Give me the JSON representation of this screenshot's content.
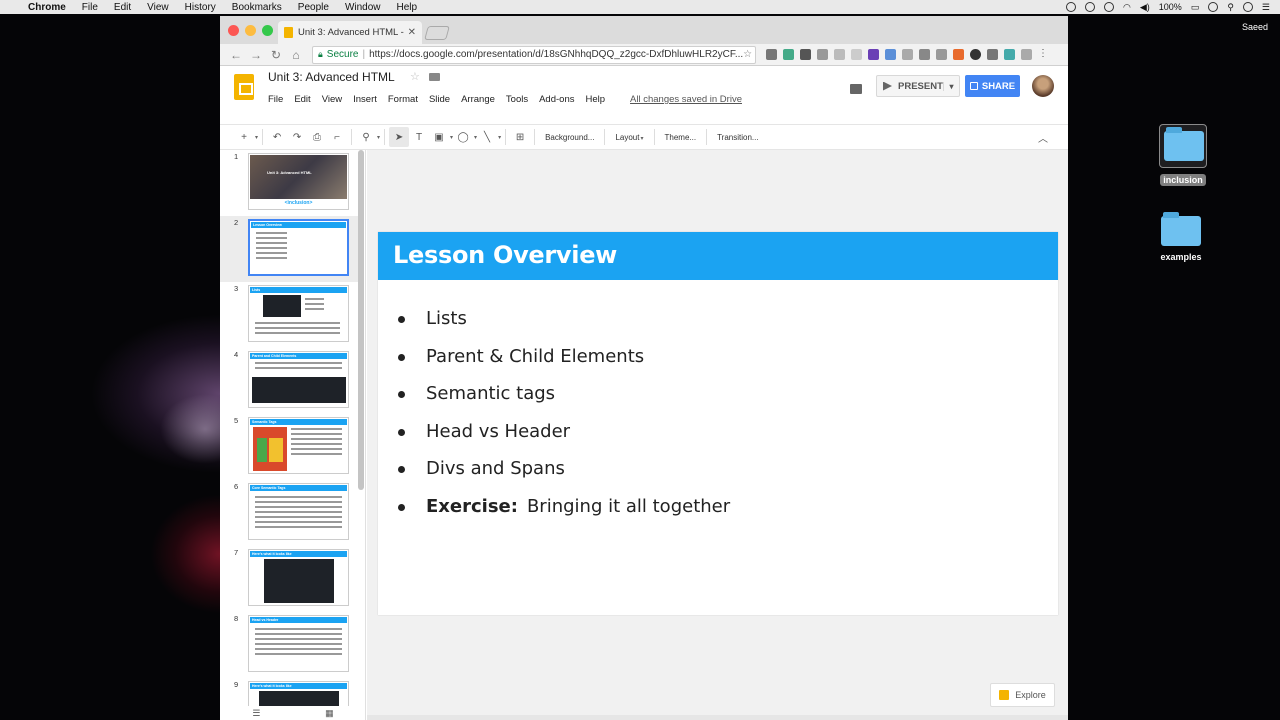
{
  "menubar": {
    "app": "Chrome",
    "items": [
      "File",
      "Edit",
      "View",
      "History",
      "Bookmarks",
      "People",
      "Window",
      "Help"
    ],
    "battery": "100%",
    "user": "Saeed"
  },
  "desktop": {
    "icons": [
      {
        "label": "inclusion",
        "selected": true
      },
      {
        "label": "examples",
        "selected": false
      }
    ]
  },
  "browser": {
    "tab_title": "Unit 3: Advanced HTML - Goo",
    "secure_label": "Secure",
    "url": "https://docs.google.com/presentation/d/18sGNhhqDQQ_z2gcc-DxfDhluwHLR2yCF..."
  },
  "app": {
    "doc_title": "Unit 3: Advanced HTML",
    "menus": [
      "File",
      "Edit",
      "View",
      "Insert",
      "Format",
      "Slide",
      "Arrange",
      "Tools",
      "Add-ons",
      "Help"
    ],
    "save_status": "All changes saved in Drive",
    "present_label": "PRESENT",
    "share_label": "SHARE",
    "toolbar": {
      "background": "Background...",
      "layout": "Layout",
      "theme": "Theme...",
      "transition": "Transition..."
    },
    "explore_label": "Explore"
  },
  "filmstrip": {
    "slides": [
      {
        "num": "1",
        "title": "Unit 3: Advanced HTML",
        "logo": "<inclusion>"
      },
      {
        "num": "2",
        "title": "Lesson Overview"
      },
      {
        "num": "3",
        "title": "Lists"
      },
      {
        "num": "4",
        "title": "Parent and Child Elements"
      },
      {
        "num": "5",
        "title": "Semantic Tags"
      },
      {
        "num": "6",
        "title": "Core Semantic Tags"
      },
      {
        "num": "7",
        "title": "Here's what it looks like"
      },
      {
        "num": "8",
        "title": "Head vs Header"
      },
      {
        "num": "9",
        "title": "Here's what it looks like"
      }
    ]
  },
  "slide": {
    "title": "Lesson Overview",
    "bullets": [
      {
        "bold": "",
        "text": "Lists"
      },
      {
        "bold": "",
        "text": "Parent & Child Elements"
      },
      {
        "bold": "",
        "text": "Semantic tags"
      },
      {
        "bold": "",
        "text": "Head vs Header"
      },
      {
        "bold": "",
        "text": "Divs and Spans"
      },
      {
        "bold": "Exercise:",
        "text": "Bringing it all together"
      }
    ]
  },
  "colors": {
    "slide_header": "#1ba3f2",
    "share": "#4285f4",
    "slides_logo": "#f4b400"
  }
}
